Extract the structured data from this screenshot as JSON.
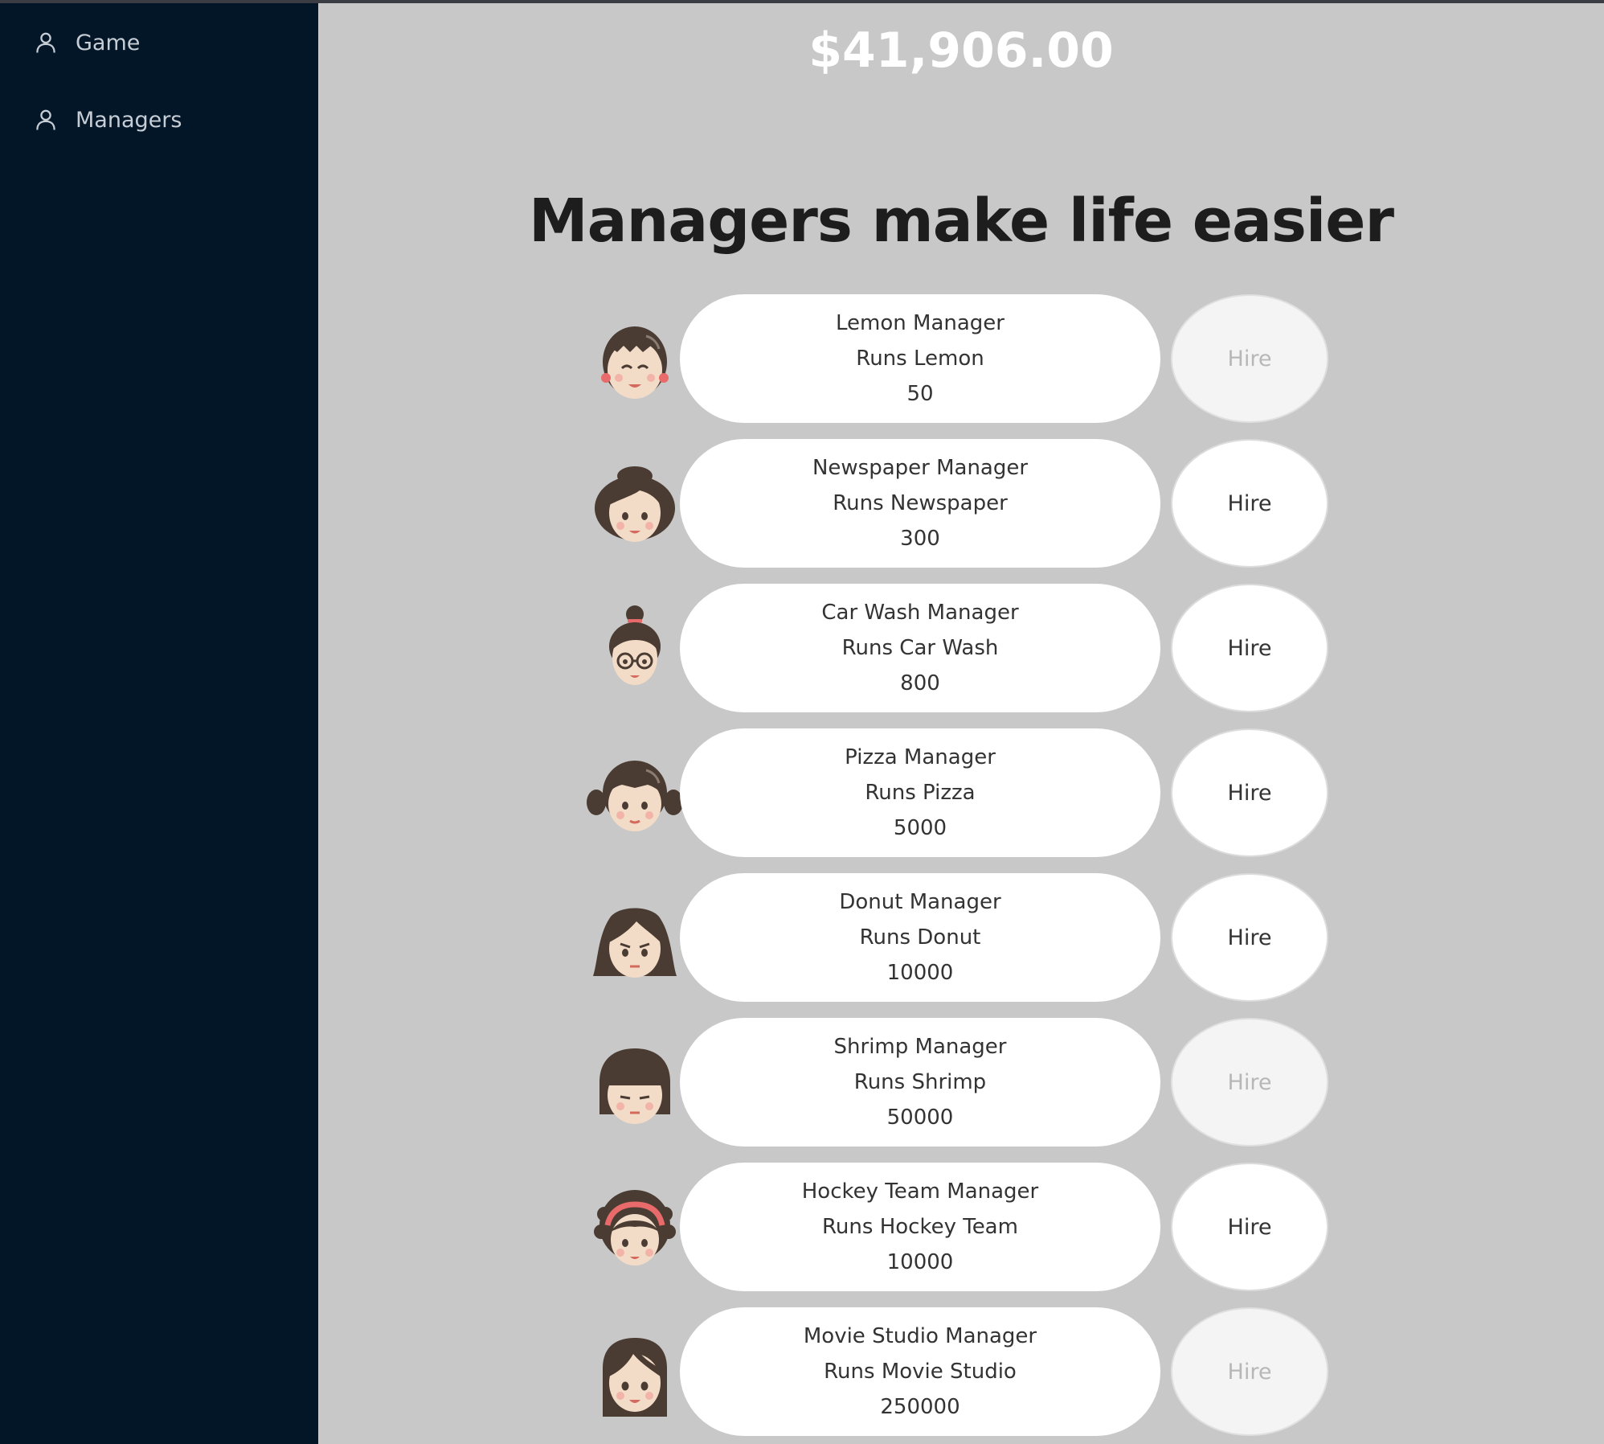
{
  "sidebar": {
    "items": [
      {
        "label": "Game",
        "icon": "user-icon"
      },
      {
        "label": "Managers",
        "icon": "user-icon"
      }
    ]
  },
  "money": "$41,906.00",
  "heading": "Managers make life easier",
  "managers": [
    {
      "name": "Lemon Manager",
      "runs": "Runs Lemon",
      "cost": "50",
      "hire_label": "Hire",
      "hire_enabled": false,
      "avatar": "avatar-girl-bangs-earrings-icon"
    },
    {
      "name": "Newspaper Manager",
      "runs": "Runs Newspaper",
      "cost": "300",
      "hire_label": "Hire",
      "hire_enabled": true,
      "avatar": "avatar-woman-curly-hair-icon"
    },
    {
      "name": "Car Wash Manager",
      "runs": "Runs Car Wash",
      "cost": "800",
      "hire_label": "Hire",
      "hire_enabled": true,
      "avatar": "avatar-woman-bun-glasses-icon"
    },
    {
      "name": "Pizza Manager",
      "runs": "Runs Pizza",
      "cost": "5000",
      "hire_label": "Hire",
      "hire_enabled": true,
      "avatar": "avatar-girl-pigtails-icon"
    },
    {
      "name": "Donut Manager",
      "runs": "Runs Donut",
      "cost": "10000",
      "hire_label": "Hire",
      "hire_enabled": true,
      "avatar": "avatar-woman-bob-hair-icon"
    },
    {
      "name": "Shrimp Manager",
      "runs": "Runs Shrimp",
      "cost": "50000",
      "hire_label": "Hire",
      "hire_enabled": false,
      "avatar": "avatar-woman-straight-bangs-icon"
    },
    {
      "name": "Hockey Team Manager",
      "runs": "Runs Hockey Team",
      "cost": "10000",
      "hire_label": "Hire",
      "hire_enabled": true,
      "avatar": "avatar-woman-headband-icon"
    },
    {
      "name": "Movie Studio Manager",
      "runs": "Runs Movie Studio",
      "cost": "250000",
      "hire_label": "Hire",
      "hire_enabled": false,
      "avatar": "avatar-woman-long-hair-icon"
    }
  ],
  "colors": {
    "sidebar_bg": "#021628",
    "page_bg": "#c8c8c8",
    "hair": "#4a3c33",
    "skin": "#f3dcc7",
    "cheek": "#f2b3a8"
  }
}
